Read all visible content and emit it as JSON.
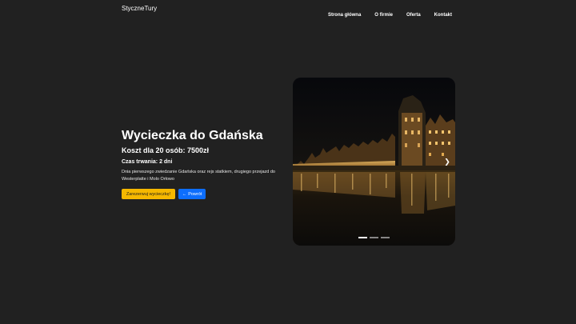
{
  "navbar": {
    "brand": "StyczneTury",
    "links": [
      "Strona główna",
      "O firmie",
      "Oferta",
      "Kontakt"
    ]
  },
  "hero": {
    "title": "Wycieczka do Gdańska",
    "price": "Koszt dla 20 osób: 7500zł",
    "duration": "Czas trwania: 2 dni",
    "description": "Dnia pierwszego zwiedzanie Gdańska oraz rejs statkiem, drugiego przejazd do Westerplatte i Molo Orłowo",
    "reserve_label": "Zarezerwuj wycieczkę!",
    "back_label": "Powrót"
  },
  "carousel": {
    "slide_count": 3,
    "active_index": 0
  },
  "colors": {
    "background": "#212121",
    "warning": "#f5b800",
    "primary": "#0d6efd"
  }
}
